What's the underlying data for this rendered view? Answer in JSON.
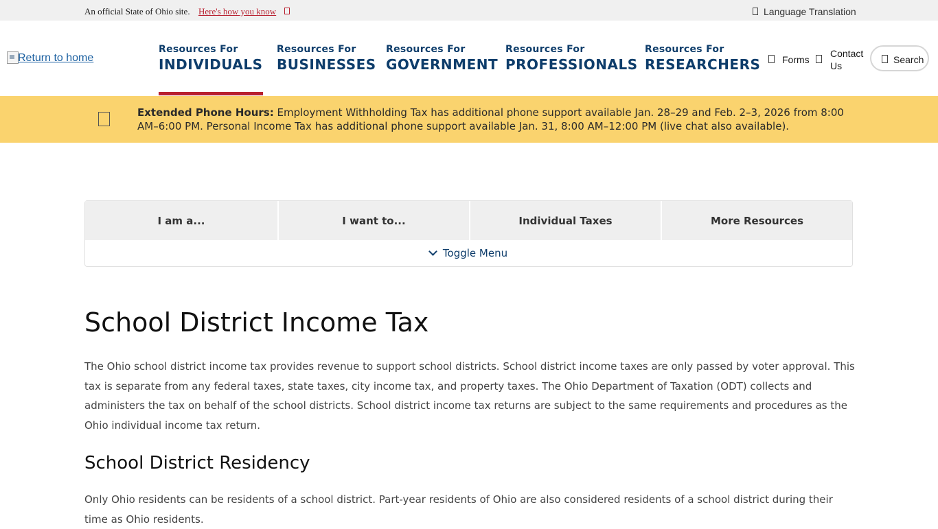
{
  "official_bar": {
    "text": "An official State of Ohio site.",
    "link": "Here's how you know",
    "language": "Language Translation"
  },
  "header": {
    "home_link": "Return to home",
    "resources": [
      {
        "small": "Resources For",
        "big": "INDIVIDUALS"
      },
      {
        "small": "Resources For",
        "big": "BUSINESSES"
      },
      {
        "small": "Resources For",
        "big": "GOVERNMENT"
      },
      {
        "small": "Resources For",
        "big": "PROFESSIONALS"
      },
      {
        "small": "Resources For",
        "big": "RESEARCHERS"
      }
    ],
    "forms": "Forms",
    "contact_1": "Contact",
    "contact_2": "Us",
    "search": "Search"
  },
  "alert": {
    "title": "Extended Phone Hours:",
    "text": " Employment Withholding Tax has additional phone support available Jan. 28–29 and Feb. 2–3, 2026 from 8:00 AM–6:00 PM. Personal Income Tax has additional phone support available Jan. 31, 8:00 AM–12:00 PM (live chat also available)."
  },
  "tabs": {
    "items": [
      "I am a...",
      "I want to...",
      "Individual Taxes",
      "More Resources"
    ],
    "toggle": "Toggle Menu"
  },
  "content": {
    "title": "School District Income Tax",
    "intro": "The Ohio school district income tax provides revenue to support school districts. School district income taxes are only passed by voter approval. This tax is separate from any federal taxes, state taxes, city income tax, and property taxes. The Ohio Department of Taxation (ODT) collects and administers the tax on behalf of the school districts. School district income tax returns are subject to the same requirements and procedures as the Ohio individual income tax return.",
    "residency_heading": "School District Residency",
    "residency_text": "Only Ohio residents can be residents of a school district. Part-year residents of Ohio are also considered residents of a school district during their time as Ohio residents."
  },
  "colors": {
    "navy": "#0e3d6b",
    "red": "#b8202f",
    "alert_yellow": "#fad36e"
  }
}
